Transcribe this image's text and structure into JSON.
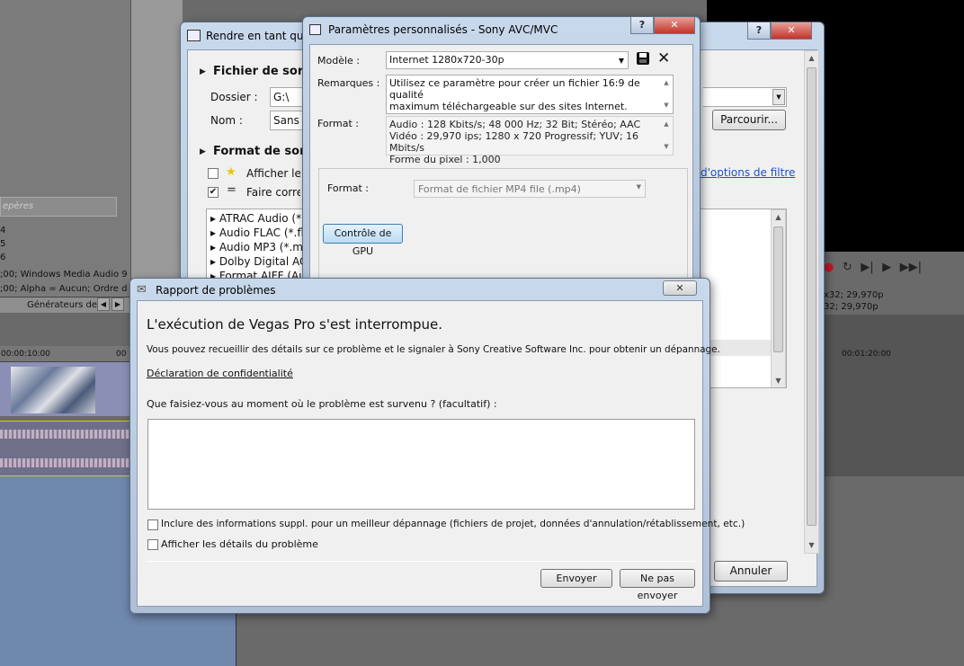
{
  "background": {
    "search_placeholder": "epères",
    "numbers": [
      "4",
      "5",
      "6"
    ],
    "media_line_1": ";00; Windows Media Audio 9",
    "media_line_2": ";00; Alpha = Aucun; Ordre d",
    "tab_label": "Générateurs de",
    "tab_prev": "◀",
    "tab_next": "▶",
    "ruler_time_1": "00:00:10:00",
    "ruler_time_2": "00",
    "ruler_time_right": "00:01:20:00",
    "preview_line_1": "x32; 29,970p",
    "preview_line_2": "32; 29,970p",
    "transport_icons": [
      "●",
      "↻",
      "▶|",
      "▶",
      "▶▶|"
    ]
  },
  "render_window": {
    "title": "Rendre en tant que",
    "section_output": "Fichier de sortie",
    "folder_label": "Dossier :",
    "folder_value": "G:\\",
    "name_label": "Nom :",
    "name_value": "Sans titre",
    "browse_button": "Parcourir...",
    "section_format": "Format de sortie",
    "show_favorites": "Afficher les favoris",
    "match_project": "Faire correspondre les paramètres du projet",
    "filter_link": "d'options de filtre",
    "formats": [
      "ATRAC Audio (*.aa3)",
      "Audio FLAC (*.flac)",
      "Audio MP3 (*.mp3)",
      "Dolby Digital AC-3",
      "Format AIFF (Audio)"
    ],
    "cancel_button": "Annuler",
    "help_button": "?",
    "close_button": "✕"
  },
  "params_window": {
    "title": "Paramètres personnalisés - Sony AVC/MVC",
    "model_label": "Modèle :",
    "model_value": "Internet 1280x720-30p",
    "save_icon": "💾",
    "delete_icon": "✕",
    "remarks_label": "Remarques :",
    "remarks_line_1": "Utilisez ce paramètre pour créer un fichier 16:9 de qualité",
    "remarks_line_2": "maximum téléchargeable sur des sites Internet.",
    "format_label": "Format :",
    "format_line_1": "Audio : 128 Kbits/s; 48 000 Hz; 32 Bit; Stéréo; AAC",
    "format_line_2": "Vidéo : 29,970 ips; 1280 x 720 Progressif; YUV; 16 Mbits/s",
    "format_line_3": "Forme du pixel : 1,000",
    "container_label": "Format :",
    "container_value": "Format de fichier MP4 file (.mp4)",
    "gpu_button": "Contrôle de GPU",
    "help_button": "?",
    "close_button": "✕"
  },
  "report_window": {
    "title": "Rapport de problèmes",
    "heading": "L'exécution de Vegas Pro s'est interrompue.",
    "description": "Vous pouvez recueillir des détails sur ce problème et le signaler à Sony Creative Software Inc. pour obtenir un dépannage.",
    "privacy_link": "Déclaration de confidentialité",
    "question": "Que faisiez-vous au moment où le problème est survenu ? (facultatif) :",
    "textarea_value": "",
    "include_info": "Inclure des informations suppl. pour un meilleur dépannage (fichiers de projet, données d'annulation/rétablissement, etc.)",
    "show_details": "Afficher les détails du problème",
    "send_button": "Envoyer",
    "dont_send_button": "Ne pas envoyer",
    "close_button": "✕"
  }
}
